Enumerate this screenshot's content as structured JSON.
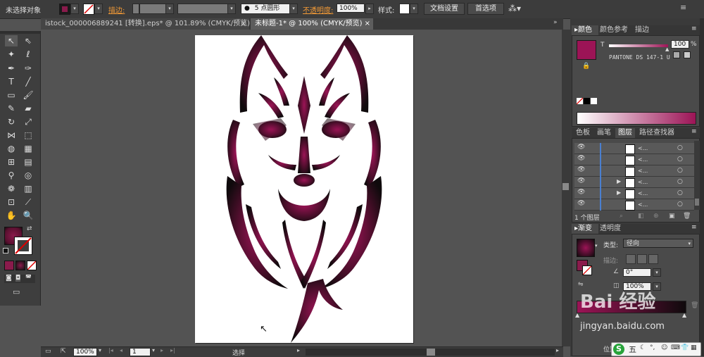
{
  "control_bar": {
    "selection_label": "未选择对象",
    "stroke_label": "描边:",
    "stroke_weight": "",
    "brush_style": "",
    "point_style": "5 点圆形",
    "opacity_label": "不透明度:",
    "opacity_value": "100%",
    "style_label": "样式:",
    "doc_setup_button": "文档设置",
    "preferences_button": "首选项",
    "fill_color": "#8a1b4c",
    "stroke_color": "#ffffff"
  },
  "document_tabs": [
    {
      "label": "istock_000006889241 [转换].eps* @ 101.89% (CMYK/预览)",
      "close": "×",
      "active": false
    },
    {
      "label": "未标题-1* @ 100% (CMYK/预览)",
      "close": "×",
      "active": true
    }
  ],
  "status_bar": {
    "zoom": "100%",
    "page": "1",
    "tool_name": "选择"
  },
  "color_panel": {
    "tabs": [
      "颜色",
      "颜色参考",
      "描边"
    ],
    "tint_label": "T",
    "tint_value": "100",
    "tint_unit": "%",
    "pantone_name": "PANTONE DS 147-1 U",
    "swatch_color": "#9c1456"
  },
  "layers_panel": {
    "tabs": [
      "色板",
      "画笔",
      "图层",
      "路径查找器"
    ],
    "rows": [
      {
        "name": "<...",
        "expandable": false
      },
      {
        "name": "<...",
        "expandable": false
      },
      {
        "name": "<...",
        "expandable": false
      },
      {
        "name": "<...",
        "expandable": true
      },
      {
        "name": "<...",
        "expandable": true
      },
      {
        "name": "<...",
        "expandable": false
      }
    ],
    "footer_count": "1 个图层"
  },
  "gradient_panel": {
    "tabs": [
      "渐变",
      "透明度"
    ],
    "type_label": "类型:",
    "type_value": "径向",
    "stroke_label": "描边:",
    "angle_value": "0°",
    "aspect_value": "100%",
    "position_label": "位置"
  },
  "watermark": {
    "logo_text": "Bai 经验",
    "site": "jingyan.baidu.com"
  },
  "ime_bar": {
    "mode": "五"
  }
}
